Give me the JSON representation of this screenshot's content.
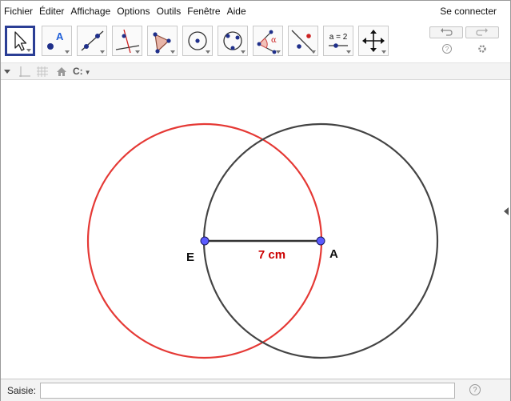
{
  "menubar": {
    "items": [
      "Fichier",
      "Éditer",
      "Affichage",
      "Options",
      "Outils",
      "Fenêtre",
      "Aide"
    ],
    "signin_label": "Se connecter"
  },
  "toolbar": {
    "tools": [
      {
        "icon": "move-arrow-icon",
        "active": true
      },
      {
        "icon": "point-icon",
        "label": "A"
      },
      {
        "icon": "line-icon"
      },
      {
        "icon": "perpendicular-line-icon"
      },
      {
        "icon": "polygon-icon"
      },
      {
        "icon": "circle-center-point-icon"
      },
      {
        "icon": "circle-three-points-icon"
      },
      {
        "icon": "angle-icon",
        "label": "α"
      },
      {
        "icon": "reflect-icon"
      },
      {
        "icon": "slider-icon",
        "label": "a = 2"
      },
      {
        "icon": "move-graphics-view-icon"
      }
    ],
    "undo_icon": "undo-icon",
    "redo_icon": "redo-icon",
    "help_icon": "help-icon",
    "settings_icon": "gear-icon"
  },
  "stylebar": {
    "icons": [
      "toggle-style-bar-icon",
      "axes-icon",
      "grid-icon",
      "home-icon",
      "point-capturing-icon"
    ],
    "capture_label": "C:"
  },
  "graphics": {
    "points": [
      {
        "name": "E",
        "color": "#5b5bff"
      },
      {
        "name": "A",
        "color": "#5b5bff"
      }
    ],
    "segment_label": "7 cm",
    "segment_label_color": "#cc0000",
    "circles": [
      {
        "center": "E",
        "color": "#e53935"
      },
      {
        "center": "A",
        "color": "#444444"
      }
    ]
  },
  "inputbar": {
    "label": "Saisie:",
    "value": "",
    "help_icon": "help-icon"
  }
}
